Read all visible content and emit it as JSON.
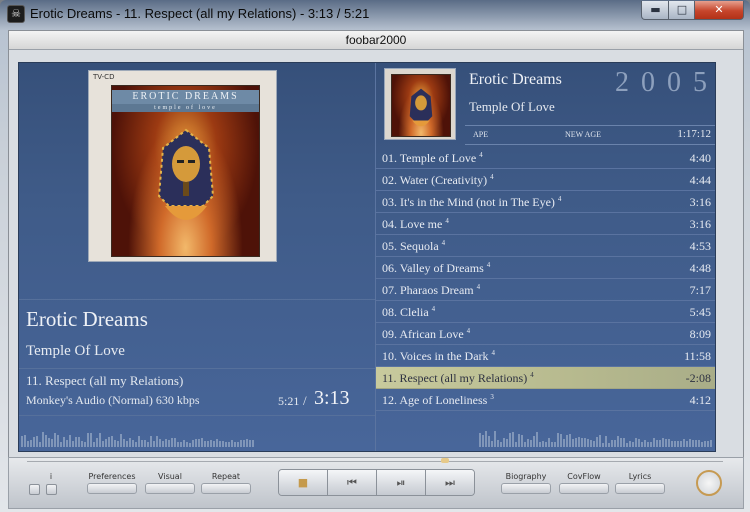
{
  "window": {
    "title": "Erotic Dreams - 11. Respect (all my Relations) - 3:13 / 5:21",
    "app_name": "foobar2000",
    "min_glyph": "▬",
    "max_glyph": "□",
    "close_glyph": "✕",
    "app_icon_glyph": "☠"
  },
  "cover": {
    "label_top": "TV-CD",
    "band_title": "EROTIC DREAMS",
    "band_subtitle": "temple of love"
  },
  "now_playing": {
    "artist": "Erotic Dreams",
    "album": "Temple Of Love",
    "track": "11. Respect (all my Relations)",
    "codec": "Monkey's Audio (Normal)  630 kbps",
    "total": "5:21",
    "sep": "/",
    "elapsed": "3:13"
  },
  "album_info": {
    "artist": "Erotic Dreams",
    "album": "Temple Of Love",
    "year": "2005",
    "codec": "APE",
    "genre": "NEW AGE",
    "length": "1:17:12"
  },
  "playlist": [
    {
      "title": "01. Temple of Love",
      "rating": "4",
      "duration": "4:40"
    },
    {
      "title": "02. Water (Creativity)",
      "rating": "4",
      "duration": "4:44"
    },
    {
      "title": "03. It's in the Mind (not in The Eye)",
      "rating": "4",
      "duration": "3:16"
    },
    {
      "title": "04. Love me",
      "rating": "4",
      "duration": "3:16"
    },
    {
      "title": "05. Sequola",
      "rating": "4",
      "duration": "4:53"
    },
    {
      "title": "06. Valley of Dreams",
      "rating": "4",
      "duration": "4:48"
    },
    {
      "title": "07. Pharaos Dream",
      "rating": "4",
      "duration": "7:17"
    },
    {
      "title": "08. Clelia",
      "rating": "4",
      "duration": "5:45"
    },
    {
      "title": "09. African Love",
      "rating": "4",
      "duration": "8:09"
    },
    {
      "title": "10. Voices in the Dark",
      "rating": "4",
      "duration": "11:58"
    },
    {
      "title": "11. Respect (all my Relations)",
      "rating": "4",
      "duration": "-2:08",
      "playing": true
    },
    {
      "title": "12. Age of Loneliness",
      "rating": "3",
      "duration": "4:12"
    }
  ],
  "controls": {
    "info_label": "i",
    "preferences": "Preferences",
    "visual": "Visual",
    "repeat": "Repeat",
    "biography": "Biography",
    "covflow": "CovFlow",
    "lyrics": "Lyrics",
    "stop_glyph": "■",
    "prev_glyph": "⏮",
    "playpause_glyph": "⏯",
    "next_glyph": "⏭"
  },
  "seek_progress": 0.6
}
